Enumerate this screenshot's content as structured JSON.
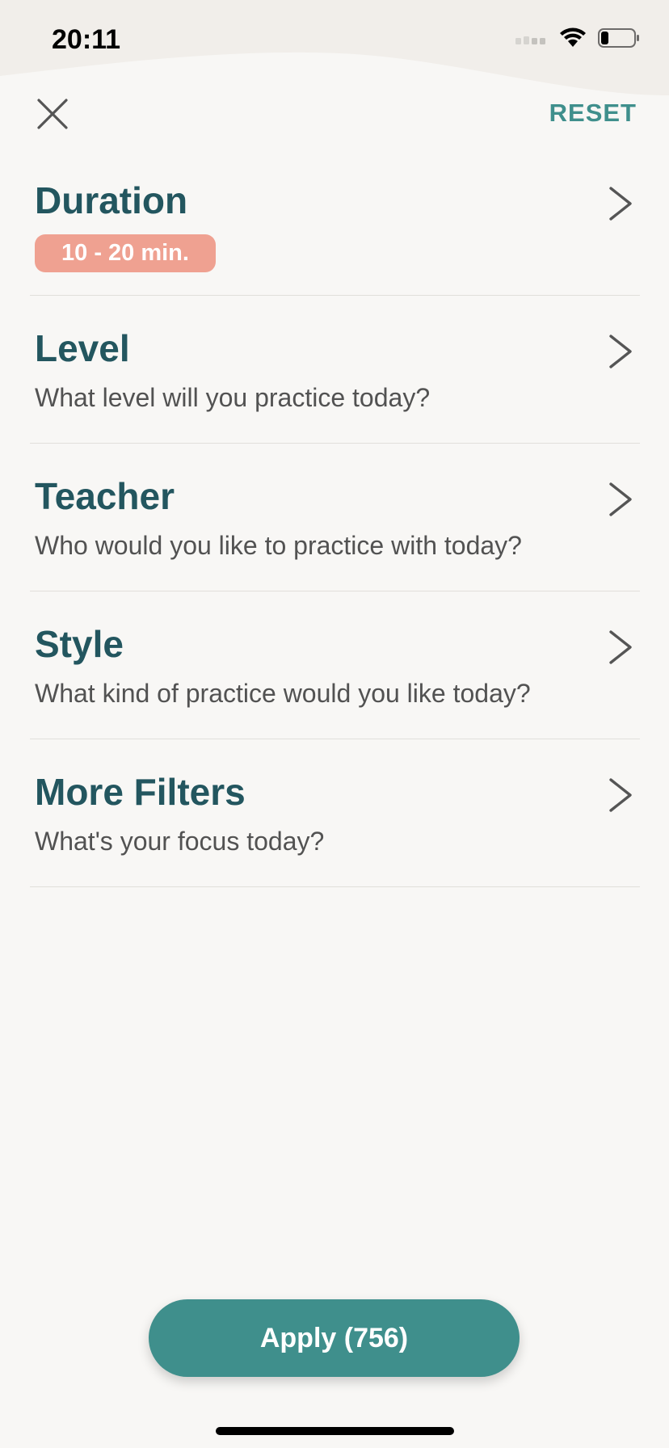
{
  "status_bar": {
    "time": "20:11"
  },
  "header": {
    "close_icon": "close-icon",
    "reset_label": "RESET"
  },
  "filters": [
    {
      "title": "Duration",
      "chip": "10 - 20 min.",
      "icon": "chevron-right-icon"
    },
    {
      "title": "Level",
      "subtitle": "What level will you practice today?",
      "icon": "chevron-right-icon"
    },
    {
      "title": "Teacher",
      "subtitle": "Who would you like to practice with today?",
      "icon": "chevron-right-icon"
    },
    {
      "title": "Style",
      "subtitle": "What kind of practice would you like today?",
      "icon": "chevron-right-icon"
    },
    {
      "title": "More Filters",
      "subtitle": "What's your focus today?",
      "icon": "chevron-right-icon"
    }
  ],
  "apply_button": {
    "label": "Apply (756)"
  },
  "colors": {
    "background": "#f8f7f5",
    "title_teal": "#23565f",
    "accent_teal": "#3f8f8c",
    "chip_salmon": "#efa191",
    "subtitle_gray": "#525252"
  }
}
